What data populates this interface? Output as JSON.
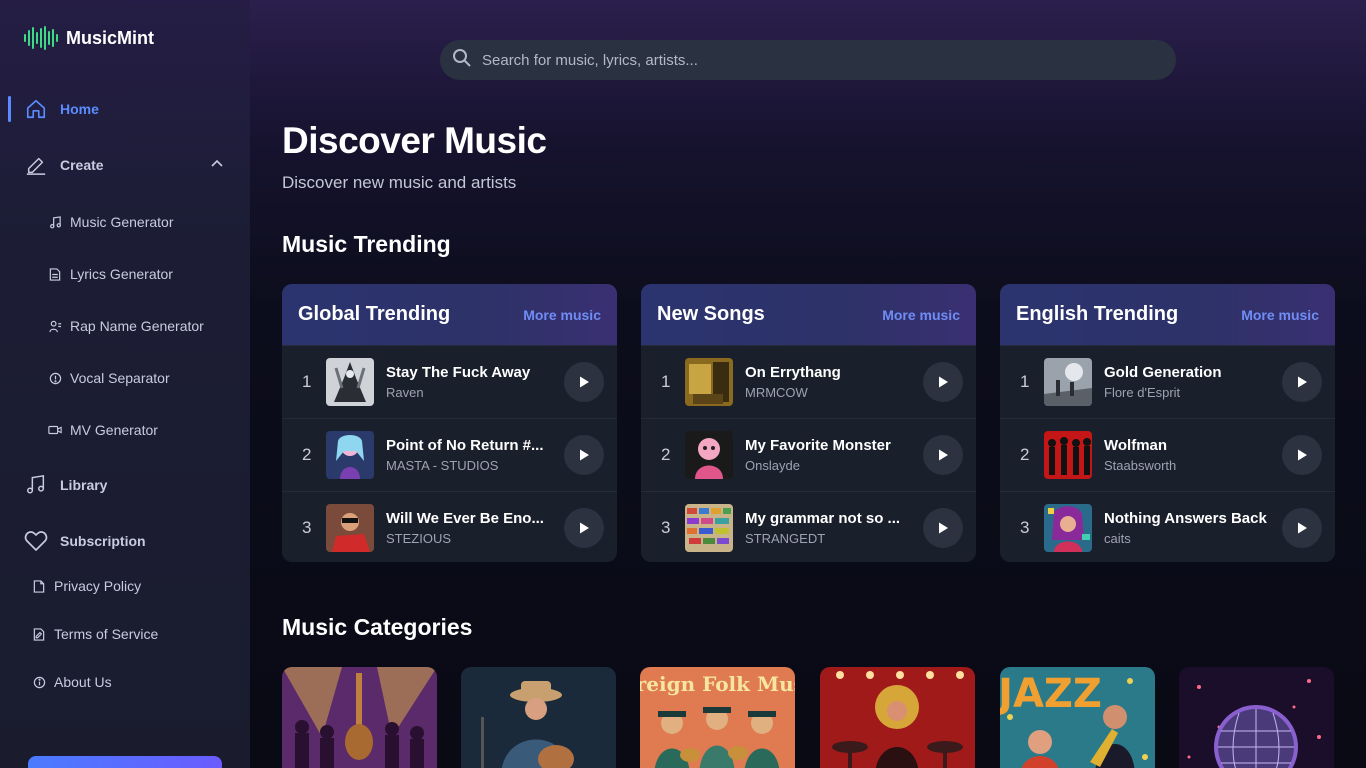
{
  "brand": {
    "name": "MusicMint",
    "icon": "waveform-icon",
    "accent": "#3ddc84"
  },
  "nav": {
    "home": {
      "label": "Home",
      "icon": "home-icon",
      "active_color": "#5b8cff"
    },
    "create": {
      "label": "Create",
      "icon": "pencil-icon",
      "expanded": true
    },
    "create_items": [
      {
        "label": "Music Generator",
        "icon": "music-note-icon"
      },
      {
        "label": "Lyrics Generator",
        "icon": "document-icon"
      },
      {
        "label": "Rap Name Generator",
        "icon": "user-icon"
      },
      {
        "label": "Vocal Separator",
        "icon": "info-circle-icon"
      },
      {
        "label": "MV Generator",
        "icon": "video-icon"
      }
    ],
    "library": {
      "label": "Library",
      "icon": "music-notes-icon"
    },
    "subscription": {
      "label": "Subscription",
      "icon": "heart-icon"
    },
    "footer_links": [
      {
        "label": "Privacy Policy",
        "icon": "document-icon"
      },
      {
        "label": "Terms of Service",
        "icon": "document-edit-icon"
      },
      {
        "label": "About Us",
        "icon": "info-circle-icon"
      }
    ]
  },
  "search": {
    "placeholder": "Search for music, lyrics, artists...",
    "value": ""
  },
  "page": {
    "title": "Discover Music",
    "subtitle": "Discover new music and artists"
  },
  "trending": {
    "section_title": "Music Trending",
    "cards": [
      {
        "title": "Global Trending",
        "more_label": "More music",
        "songs": [
          {
            "rank": "1",
            "title": "Stay The Fuck Away",
            "artist": "Raven"
          },
          {
            "rank": "2",
            "title": "Point of No Return #...",
            "artist": "MASTA - STUDIOS"
          },
          {
            "rank": "3",
            "title": "Will We Ever Be Eno...",
            "artist": "STEZIOUS"
          }
        ]
      },
      {
        "title": "New Songs",
        "more_label": "More music",
        "songs": [
          {
            "rank": "1",
            "title": "On Errythang",
            "artist": "MRMCOW"
          },
          {
            "rank": "2",
            "title": "My Favorite Monster",
            "artist": "Onslayde"
          },
          {
            "rank": "3",
            "title": "My grammar not so ...",
            "artist": "STRANGEDT"
          }
        ]
      },
      {
        "title": "English Trending",
        "more_label": "More music",
        "songs": [
          {
            "rank": "1",
            "title": "Gold Generation",
            "artist": "Flore d'Esprit"
          },
          {
            "rank": "2",
            "title": "Wolfman",
            "artist": "Staabsworth"
          },
          {
            "rank": "3",
            "title": "Nothing Answers Back",
            "artist": "caits"
          }
        ]
      }
    ]
  },
  "categories": {
    "section_title": "Music Categories",
    "items": [
      {
        "image_text": ""
      },
      {
        "image_text": ""
      },
      {
        "image_text": "Foreign Folk Music"
      },
      {
        "image_text": ""
      },
      {
        "image_text": "JAZZ"
      },
      {
        "image_text": ""
      }
    ]
  }
}
